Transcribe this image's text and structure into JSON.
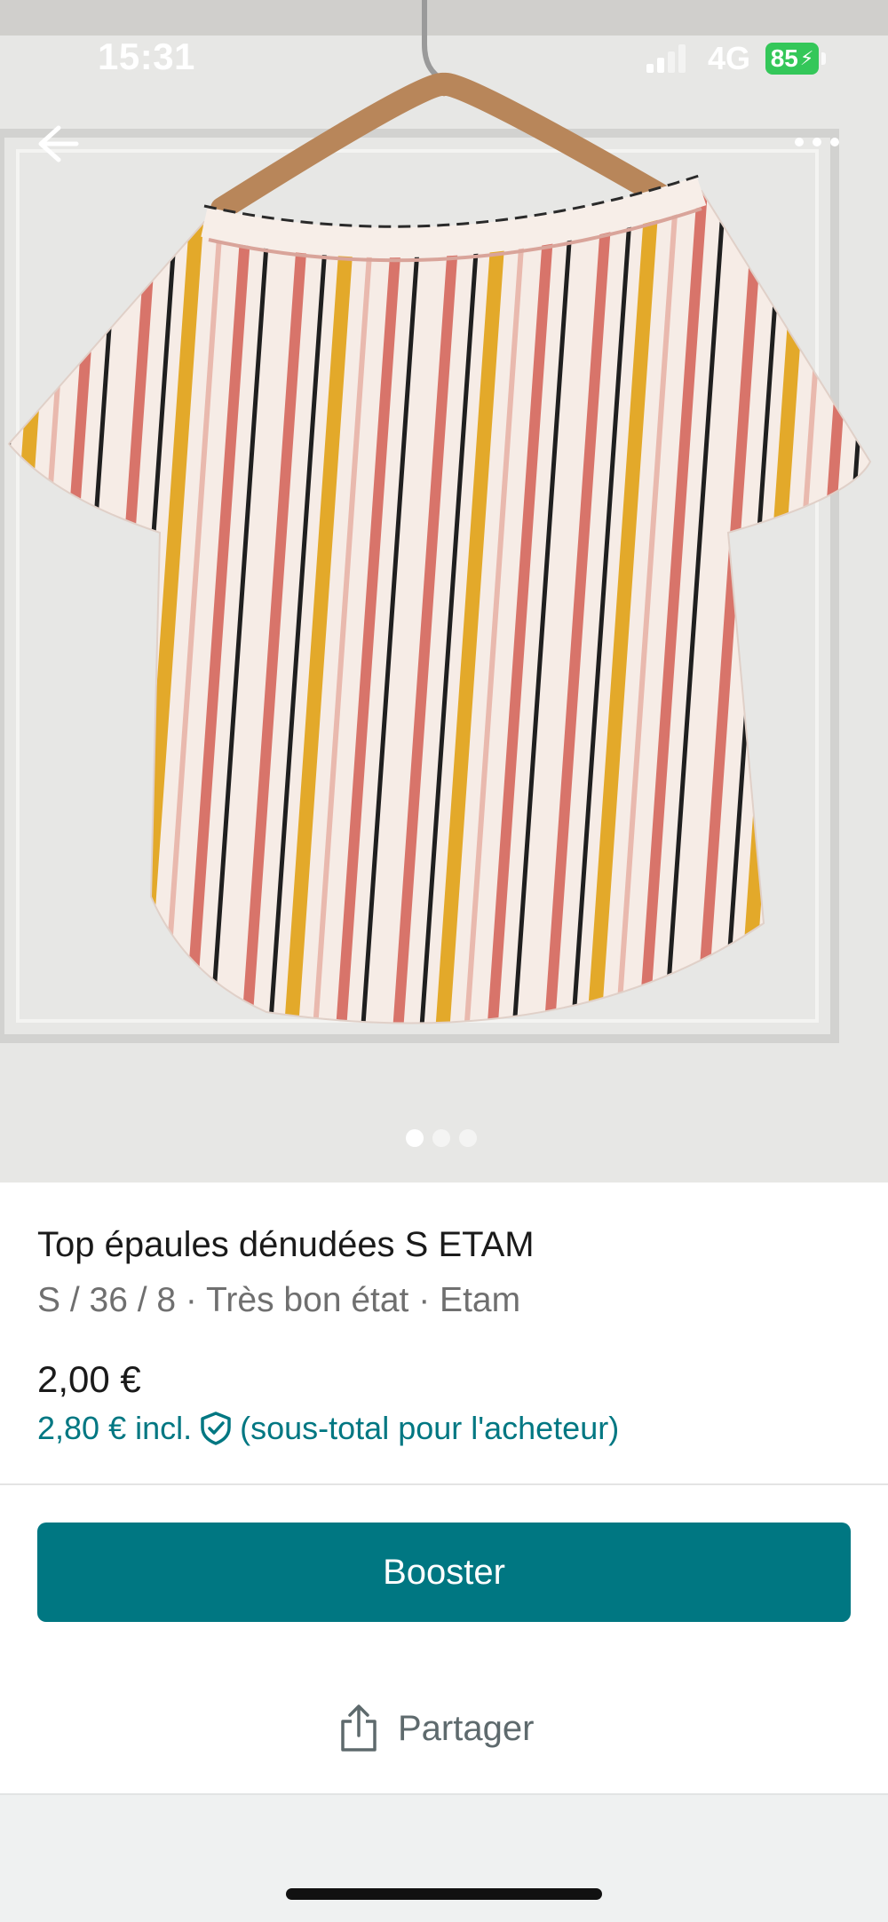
{
  "status_bar": {
    "time": "15:31",
    "network": "4G",
    "battery": "85",
    "icons": [
      "signal-icon",
      "charging-bolt-icon"
    ]
  },
  "header": {
    "icons": [
      "back-arrow-icon",
      "more-options-icon"
    ]
  },
  "gallery": {
    "image_count": 3,
    "active_index": 0
  },
  "item": {
    "title": "Top épaules dénudées S ETAM",
    "subtitle": "S / 36 / 8 · Très bon état · Etam",
    "price": "2,00 €",
    "buyer_price": "2,80 € incl.",
    "buyer_price_note": "(sous-total pour l'acheteur)",
    "protection_icon": "shield-check-icon"
  },
  "actions": {
    "booster_label": "Booster",
    "share_label": "Partager",
    "share_icon": "share-icon"
  },
  "colors": {
    "accent": "#007782",
    "battery": "#34c759"
  }
}
